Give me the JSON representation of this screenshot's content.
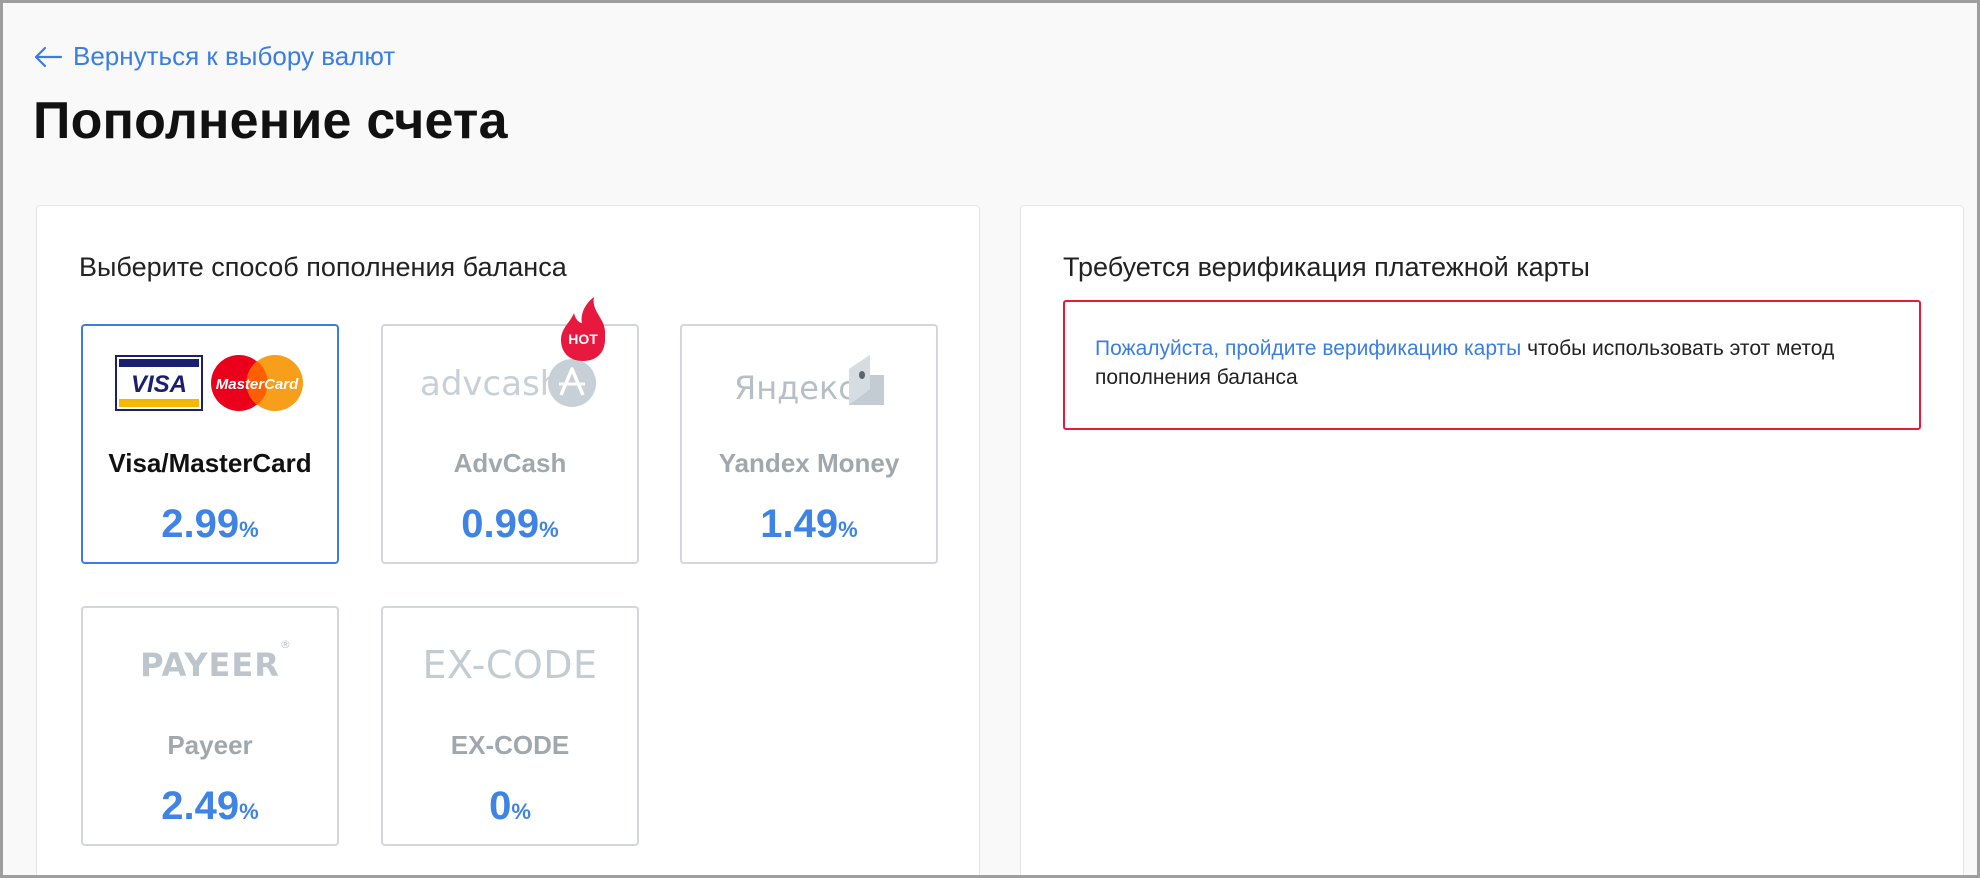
{
  "header": {
    "back_label": "Вернуться к выбору валют",
    "title": "Пополнение счета"
  },
  "left_panel": {
    "heading": "Выберите способ пополнения баланса",
    "hot_badge": "HOT",
    "methods": [
      {
        "name": "Visa/MasterCard",
        "fee": "2.99",
        "unit": "%",
        "logo_visa": "VISA",
        "logo_mc": "MasterCard",
        "selected": true
      },
      {
        "name": "AdvCash",
        "fee": "0.99",
        "unit": "%",
        "logo": "advcash"
      },
      {
        "name": "Yandex Money",
        "fee": "1.49",
        "unit": "%",
        "logo": "Яндекс"
      },
      {
        "name": "Payeer",
        "fee": "2.49",
        "unit": "%",
        "logo": "PAYEER",
        "logo_mark": "®"
      },
      {
        "name": "EX-CODE",
        "fee": "0",
        "unit": "%",
        "logo": "EX-CODE"
      }
    ]
  },
  "right_panel": {
    "heading": "Требуется верификация платежной карты",
    "link_text": "Пожалуйста, пройдите верификацию карты",
    "message": " чтобы использовать этот метод пополнения баланса"
  },
  "colors": {
    "accent": "#3b7de3",
    "error_border": "#e8193e",
    "hot": "#e8193e"
  },
  "icons": [
    "arrow-left-icon",
    "visa-logo-icon",
    "mastercard-logo-icon",
    "advcash-logo-icon",
    "yandex-money-logo-icon",
    "flame-icon"
  ]
}
